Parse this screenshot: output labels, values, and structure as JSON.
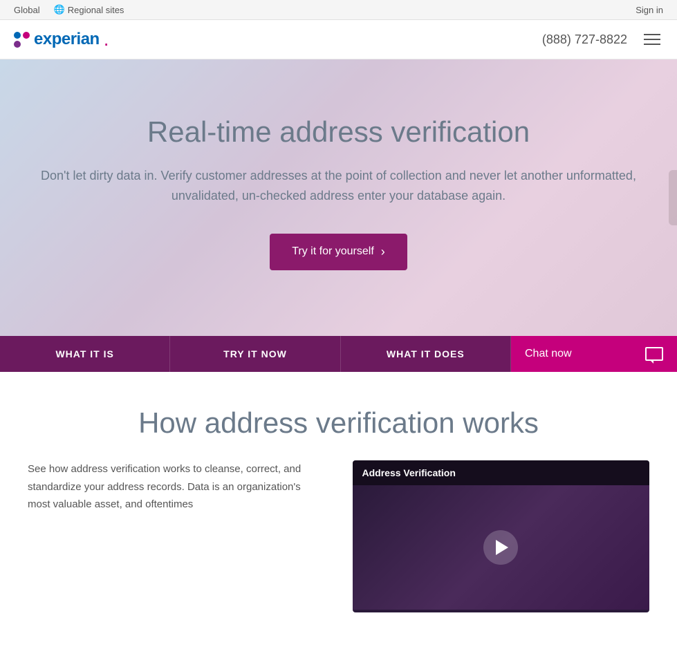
{
  "topbar": {
    "global": "Global",
    "regional": "Regional sites",
    "signin": "Sign in"
  },
  "header": {
    "logo_text": "experian",
    "phone": "(888) 727-8822"
  },
  "hero": {
    "title": "Real-time address verification",
    "subtitle": "Don't let dirty data in. Verify customer addresses at the point of collection and never let another unformatted, unvalidated, un-checked address enter your database again.",
    "cta_label": "Try it for yourself"
  },
  "nav": {
    "tab1": "WHAT IT IS",
    "tab2": "TRY IT NOW",
    "tab3": "WHAT IT DOES",
    "chat": "Chat now"
  },
  "main": {
    "section_title": "How address verification works",
    "body_text": "See how address verification works to cleanse, correct, and standardize your address records. Data is an organization's most valuable asset, and oftentimes",
    "video_title": "Address Verification"
  }
}
